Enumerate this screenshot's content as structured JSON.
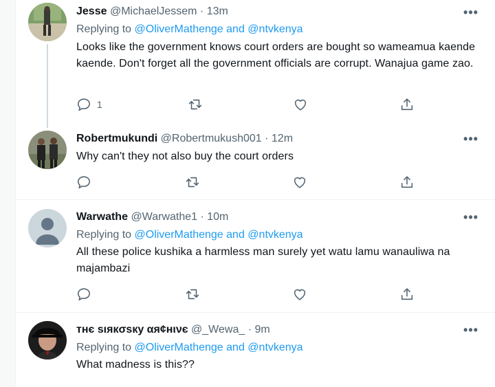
{
  "tweets": [
    {
      "name": "Jesse",
      "handle": "@MichaelJessem",
      "time": "13m",
      "replying_label": "Replying to",
      "mention1": "@OliverMathenge",
      "and": "and",
      "mention2": "@ntvkenya",
      "text": "Looks like the government knows court orders are bought so wameamua kaende kaende. Don't forget all the government officials are corrupt. Wanajua game zao.",
      "reply_count": "1"
    },
    {
      "name": "Robertmukundi",
      "handle": "@Robertmukush001",
      "time": "12m",
      "text": "Why can't they not also buy the court orders"
    },
    {
      "name": "Warwathe",
      "handle": "@Warwathe1",
      "time": "10m",
      "replying_label": "Replying to",
      "mention1": "@OliverMathenge",
      "and": "and",
      "mention2": "@ntvkenya",
      "text": "All these police kushika a harmless man surely yet watu lamu wanauliwa na majambazi"
    },
    {
      "name": "тнє ѕιякσѕку αя¢нινє",
      "handle": "@_Wewa_",
      "time": "9m",
      "replying_label": "Replying to",
      "mention1": "@OliverMathenge",
      "and": "and",
      "mention2": "@ntvkenya",
      "text": "What madness is this??"
    }
  ],
  "separator": "·",
  "icons": [
    "reply-icon",
    "retweet-icon",
    "like-icon",
    "share-icon",
    "more-icon"
  ],
  "colors": {
    "link": "#1d9bf0",
    "secondary": "#536471",
    "text": "#0f1419"
  }
}
